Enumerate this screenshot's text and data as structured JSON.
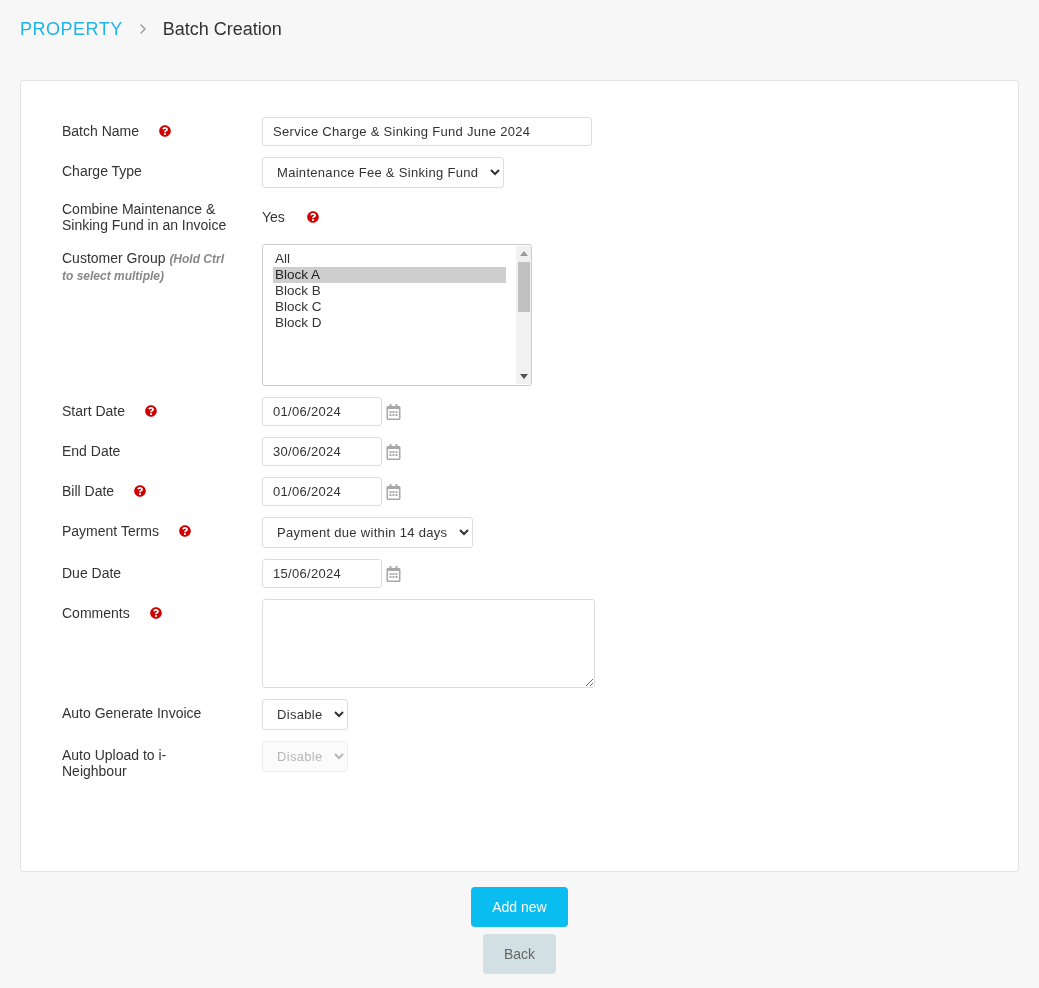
{
  "breadcrumb": {
    "section": "PROPERTY",
    "current": "Batch Creation"
  },
  "fields": [
    {
      "kind": "text",
      "label": "Batch Name",
      "help": true,
      "value": "Service Charge & Sinking Fund June 2024"
    },
    {
      "kind": "select",
      "label": "Charge Type",
      "help": false,
      "value": "Maintenance Fee & Sinking Fund",
      "disabled": false
    },
    {
      "kind": "static",
      "label": "Combine Maintenance & Sinking Fund in an Invoice",
      "help": false,
      "value": "Yes",
      "value_help": true
    },
    {
      "kind": "listbox",
      "label": "Customer Group",
      "hint": "(Hold Ctrl to select multiple)",
      "help": false,
      "options": [
        {
          "label": "All",
          "selected": false
        },
        {
          "label": "Block A",
          "selected": true
        },
        {
          "label": "Block B",
          "selected": false
        },
        {
          "label": "Block C",
          "selected": false
        },
        {
          "label": "Block D",
          "selected": false
        }
      ]
    },
    {
      "kind": "date",
      "label": "Start Date",
      "help": true,
      "value": "01/06/2024"
    },
    {
      "kind": "date",
      "label": "End Date",
      "help": false,
      "value": "30/06/2024"
    },
    {
      "kind": "date",
      "label": "Bill Date",
      "help": true,
      "value": "01/06/2024"
    },
    {
      "kind": "select",
      "label": "Payment Terms",
      "help": true,
      "value": "Payment due within 14 days",
      "disabled": false
    },
    {
      "kind": "date",
      "label": "Due Date",
      "help": false,
      "value": "15/06/2024"
    },
    {
      "kind": "textarea",
      "label": "Comments",
      "help": true
    },
    {
      "kind": "select",
      "label": "Auto Generate Invoice",
      "help": false,
      "value": "Disable",
      "disabled": false
    },
    {
      "kind": "select",
      "label": "Auto Upload to i-Neighbour",
      "help": false,
      "value": "Disable",
      "disabled": true
    }
  ],
  "buttons": {
    "primary": "Add new",
    "secondary": "Back"
  }
}
